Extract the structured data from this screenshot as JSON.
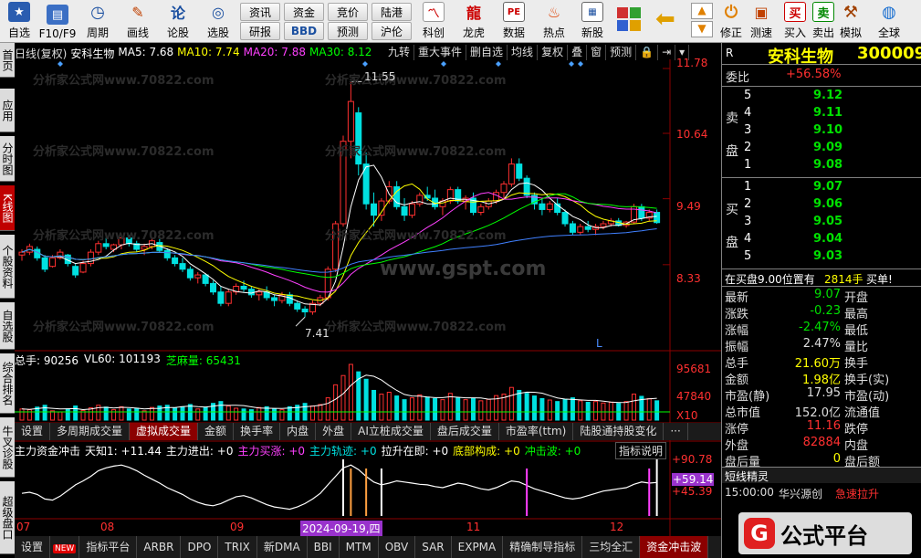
{
  "toolbar": {
    "buttons": [
      {
        "label": "自选",
        "icon": "star-icon"
      },
      {
        "label": "F10/F9",
        "icon": "info-icon"
      },
      {
        "label": "周期",
        "icon": "clock-icon"
      },
      {
        "label": "画线",
        "icon": "pencil-icon"
      },
      {
        "label": "论股",
        "icon": "chat-icon"
      },
      {
        "label": "选股",
        "icon": "scan-icon"
      }
    ],
    "small_top": [
      "资讯",
      "资金",
      "竞价",
      "陆港"
    ],
    "small_bottom": [
      "研报",
      "BBD",
      "预测",
      "沪伦"
    ],
    "buttons2": [
      {
        "label": "科创",
        "icon": "chart-icon"
      },
      {
        "label": "龙虎",
        "icon": "dragon-icon"
      },
      {
        "label": "数据",
        "icon": "pe-icon"
      },
      {
        "label": "热点",
        "icon": "fire-icon"
      },
      {
        "label": "新股",
        "icon": "newstock-icon"
      }
    ],
    "buttons3": [
      {
        "label": "修正",
        "icon": "up-arrow-icon"
      },
      {
        "label": "测速",
        "icon": "speed-icon"
      },
      {
        "label": "买入",
        "icon": "buy-icon"
      },
      {
        "label": "卖出",
        "icon": "sell-icon"
      },
      {
        "label": "模拟",
        "icon": "hammer-icon"
      },
      {
        "label": "全球",
        "icon": "globe-icon"
      }
    ],
    "buy_glyph": "买",
    "sell_glyph": "卖"
  },
  "left_tabs": [
    "首页",
    "应用",
    "分时图",
    "K线图",
    "个股资料",
    "自选股",
    "综合排名",
    "牛叉诊股",
    "超级盘口"
  ],
  "chart": {
    "info": {
      "period": "日线(复权)",
      "name": "安科生物",
      "ma5": "MA5: 7.68",
      "ma10": "MA10: 7.74",
      "ma20": "MA20: 7.88",
      "ma30": "MA30: 8.12"
    },
    "top_tabs": [
      "九转",
      "重大事件",
      "删自选",
      "均线",
      "复权",
      "叠",
      "窗",
      "预测"
    ],
    "price_ticks": [
      "11.78",
      "10.64",
      "9.49",
      "8.33"
    ],
    "high_label": "11.55",
    "low_label": "7.41",
    "l_marker": "L",
    "watermark": "分析家公式网www.70822.com",
    "watermark2": "www.gspt.com",
    "vol_info": {
      "total": "总手: 90256",
      "vl60": "VL60: 101193",
      "sesame": "芝麻量: 65431"
    },
    "vol_ticks": [
      "95681",
      "47840",
      "X10"
    ],
    "tabs": [
      "设置",
      "多周期成交量",
      "虚拟成交量",
      "金额",
      "换手率",
      "内盘",
      "外盘",
      "AI立桩成交量",
      "盘后成交量",
      "市盈率(ttm)",
      "陆股通持股变化",
      "···"
    ],
    "ind_info": {
      "name": "主力资金冲击",
      "tianzhi": "天知1: +11.44",
      "jinchu": "主力进出: +0",
      "maizhang": "主力买涨: +0",
      "guiji": "主力轨迹: +0",
      "lasheng": "拉升在即: +0",
      "dibu": "底部构成: +0",
      "chongji": "冲击波: +0",
      "help": "指标说明"
    },
    "ind_ticks": [
      "+90.78",
      "+59.14",
      "+45.39"
    ],
    "date_labels": [
      "07",
      "08",
      "09",
      "2024-09-19,四",
      "11",
      "12"
    ],
    "ind_tabs": [
      "设置",
      "NEW",
      "指标平台",
      "ARBR",
      "DPO",
      "TRIX",
      "新DMA",
      "BBI",
      "MTM",
      "OBV",
      "SAR",
      "EXPMA",
      "精确制导指标",
      "三均全汇",
      "资金冲击波"
    ],
    "candles": [
      [
        8.5,
        8.6,
        8.4,
        8.55
      ],
      [
        8.55,
        8.7,
        8.5,
        8.65
      ],
      [
        8.6,
        8.65,
        8.4,
        8.45
      ],
      [
        8.45,
        8.5,
        8.2,
        8.25
      ],
      [
        8.3,
        8.5,
        8.28,
        8.45
      ],
      [
        8.45,
        8.6,
        8.42,
        8.55
      ],
      [
        8.5,
        8.52,
        8.3,
        8.35
      ],
      [
        8.3,
        8.35,
        8.1,
        8.15
      ],
      [
        8.2,
        8.4,
        8.18,
        8.35
      ],
      [
        8.35,
        8.6,
        8.3,
        8.55
      ],
      [
        8.55,
        8.75,
        8.5,
        8.7
      ],
      [
        8.7,
        8.8,
        8.6,
        8.65
      ],
      [
        8.6,
        8.7,
        8.55,
        8.68
      ],
      [
        8.68,
        8.85,
        8.6,
        8.8
      ],
      [
        8.8,
        8.85,
        8.65,
        8.7
      ],
      [
        8.7,
        8.75,
        8.55,
        8.6
      ],
      [
        8.6,
        8.7,
        8.5,
        8.65
      ],
      [
        8.65,
        8.8,
        8.6,
        8.75
      ],
      [
        8.72,
        8.78,
        8.55,
        8.58
      ],
      [
        8.58,
        8.62,
        8.4,
        8.45
      ],
      [
        8.45,
        8.5,
        8.3,
        8.35
      ],
      [
        8.35,
        8.45,
        8.2,
        8.25
      ],
      [
        8.25,
        8.3,
        8.05,
        8.1
      ],
      [
        8.1,
        8.2,
        8.0,
        8.15
      ],
      [
        8.15,
        8.18,
        7.95,
        8.0
      ],
      [
        8.0,
        8.05,
        7.8,
        7.85
      ],
      [
        7.85,
        7.95,
        7.6,
        7.65
      ],
      [
        7.65,
        7.9,
        7.6,
        7.85
      ],
      [
        7.85,
        8.0,
        7.8,
        7.95
      ],
      [
        7.95,
        8.05,
        7.85,
        7.9
      ],
      [
        7.9,
        7.95,
        7.75,
        7.8
      ],
      [
        7.8,
        7.9,
        7.7,
        7.85
      ],
      [
        7.85,
        7.95,
        7.7,
        7.75
      ],
      [
        7.75,
        7.8,
        7.6,
        7.7
      ],
      [
        7.7,
        7.85,
        7.65,
        7.8
      ],
      [
        7.8,
        7.85,
        7.6,
        7.65
      ],
      [
        7.65,
        7.7,
        7.5,
        7.55
      ],
      [
        7.55,
        7.6,
        7.41,
        7.5
      ],
      [
        7.5,
        7.7,
        7.45,
        7.65
      ],
      [
        7.65,
        7.8,
        7.6,
        7.75
      ],
      [
        7.75,
        8.3,
        7.7,
        8.25
      ],
      [
        8.25,
        9.1,
        8.2,
        9.05
      ],
      [
        9.05,
        10.6,
        9.0,
        10.5
      ],
      [
        10.5,
        11.55,
        10.2,
        11.2
      ],
      [
        11.0,
        11.1,
        9.9,
        10.1
      ],
      [
        10.1,
        10.3,
        9.3,
        9.4
      ],
      [
        9.4,
        9.6,
        9.0,
        9.2
      ],
      [
        9.2,
        9.5,
        9.1,
        9.45
      ],
      [
        9.45,
        9.8,
        9.4,
        9.7
      ],
      [
        9.7,
        9.8,
        9.3,
        9.35
      ],
      [
        9.35,
        9.5,
        9.1,
        9.2
      ],
      [
        9.2,
        9.45,
        9.15,
        9.4
      ],
      [
        9.4,
        9.6,
        9.35,
        9.55
      ],
      [
        9.55,
        9.7,
        9.45,
        9.5
      ],
      [
        9.5,
        9.65,
        9.3,
        9.35
      ],
      [
        9.35,
        9.5,
        9.2,
        9.45
      ],
      [
        9.45,
        9.7,
        9.4,
        9.65
      ],
      [
        9.65,
        9.7,
        9.4,
        9.45
      ],
      [
        9.45,
        9.55,
        9.3,
        9.5
      ],
      [
        9.5,
        9.6,
        9.2,
        9.25
      ],
      [
        9.25,
        9.4,
        9.2,
        9.35
      ],
      [
        9.35,
        9.5,
        9.3,
        9.45
      ],
      [
        9.45,
        9.65,
        9.4,
        9.6
      ],
      [
        9.6,
        9.8,
        9.5,
        9.75
      ],
      [
        9.75,
        10.2,
        9.7,
        10.1
      ],
      [
        10.1,
        10.2,
        9.8,
        9.85
      ],
      [
        9.85,
        9.9,
        9.5,
        9.55
      ],
      [
        9.55,
        9.6,
        9.3,
        9.4
      ],
      [
        9.4,
        9.5,
        9.2,
        9.3
      ],
      [
        9.3,
        9.45,
        9.25,
        9.4
      ],
      [
        9.4,
        9.5,
        9.2,
        9.25
      ],
      [
        9.25,
        9.3,
        9.0,
        9.05
      ],
      [
        9.05,
        9.1,
        8.85,
        8.9
      ],
      [
        8.9,
        9.05,
        8.85,
        9.0
      ],
      [
        9.0,
        9.1,
        8.9,
        8.95
      ],
      [
        8.95,
        9.05,
        8.85,
        9.0
      ],
      [
        9.0,
        9.1,
        8.95,
        9.05
      ],
      [
        9.05,
        9.15,
        9.0,
        9.1
      ],
      [
        9.1,
        9.15,
        9.0,
        9.02
      ],
      [
        9.02,
        9.1,
        8.98,
        9.08
      ],
      [
        9.08,
        9.4,
        9.05,
        9.35
      ],
      [
        9.35,
        9.4,
        9.1,
        9.15
      ],
      [
        9.15,
        9.3,
        9.1,
        9.25
      ],
      [
        9.25,
        9.3,
        9.05,
        9.07
      ]
    ],
    "volume": [
      30,
      28,
      35,
      40,
      25,
      22,
      30,
      38,
      26,
      33,
      40,
      35,
      28,
      36,
      30,
      32,
      25,
      34,
      38,
      40,
      33,
      36,
      42,
      30,
      35,
      45,
      50,
      38,
      32,
      30,
      28,
      34,
      36,
      30,
      28,
      36,
      40,
      45,
      38,
      42,
      60,
      95,
      120,
      150,
      130,
      110,
      80,
      70,
      75,
      65,
      55,
      60,
      68,
      62,
      58,
      55,
      72,
      60,
      55,
      58,
      52,
      56,
      66,
      70,
      88,
      80,
      72,
      65,
      58,
      54,
      50,
      56,
      60,
      52,
      48,
      50,
      46,
      48,
      45,
      50,
      70,
      64,
      58,
      52
    ],
    "ind": [
      40,
      42,
      38,
      30,
      28,
      35,
      45,
      55,
      62,
      70,
      80,
      85,
      88,
      90,
      86,
      80,
      72,
      65,
      58,
      50,
      44,
      38,
      30,
      24,
      20,
      18,
      22,
      28,
      34,
      36,
      32,
      26,
      20,
      16,
      14,
      12,
      16,
      22,
      30,
      40,
      55,
      70,
      85,
      90,
      82,
      70,
      60,
      55,
      58,
      62,
      60,
      58,
      56,
      55,
      52,
      50,
      54,
      58,
      56,
      52,
      48,
      46,
      50,
      56,
      62,
      60,
      54,
      48,
      44,
      40,
      36,
      32,
      30,
      32,
      36,
      40,
      44,
      46,
      48,
      50,
      56,
      60,
      58,
      59.14
    ]
  },
  "right": {
    "title": "安科生物",
    "code": "300009",
    "r_mark": "R",
    "weibi": {
      "label": "委比",
      "value": "+56.58%"
    },
    "sell_label": [
      "卖",
      "盘"
    ],
    "buy_label": [
      "买",
      "盘"
    ],
    "asks": [
      {
        "lv": "5",
        "p": "9.12"
      },
      {
        "lv": "4",
        "p": "9.11"
      },
      {
        "lv": "3",
        "p": "9.10"
      },
      {
        "lv": "2",
        "p": "9.09"
      },
      {
        "lv": "1",
        "p": "9.08"
      }
    ],
    "bids": [
      {
        "lv": "1",
        "p": "9.07"
      },
      {
        "lv": "2",
        "p": "9.06"
      },
      {
        "lv": "3",
        "p": "9.05"
      },
      {
        "lv": "4",
        "p": "9.04"
      },
      {
        "lv": "5",
        "p": "9.03"
      }
    ],
    "notice": {
      "text": "在买盘9.00位置有",
      "qty": "2814手",
      "tag": "买单!"
    },
    "stats": [
      {
        "k": "最新",
        "v": "9.07",
        "k2": "开盘",
        "c": "#00e000"
      },
      {
        "k": "涨跌",
        "v": "-0.23",
        "k2": "最高",
        "c": "#00e000"
      },
      {
        "k": "涨幅",
        "v": "-2.47%",
        "k2": "最低",
        "c": "#00e000"
      },
      {
        "k": "振幅",
        "v": "2.47%",
        "k2": "量比",
        "c": "#ddd"
      },
      {
        "k": "总手",
        "v": "21.60万",
        "k2": "换手",
        "c": "#ffff00"
      },
      {
        "k": "金额",
        "v": "1.98亿",
        "k2": "换手(实)",
        "c": "#ffff00"
      },
      {
        "k": "市盈(静)",
        "v": "17.95",
        "k2": "市盈(动)",
        "c": "#ddd"
      },
      {
        "k": "总市值",
        "v": "152.0亿",
        "k2": "流通值",
        "c": "#ddd"
      },
      {
        "k": "涨停",
        "v": "11.16",
        "k2": "跌停",
        "c": "#ff3030"
      },
      {
        "k": "外盘",
        "v": "82884",
        "k2": "内盘",
        "c": "#ff3030"
      },
      {
        "k": "盘后量",
        "v": "0",
        "k2": "盘后额",
        "c": "#ffff00"
      }
    ],
    "short_title": "短线精灵",
    "short_item": {
      "time": "15:00:00",
      "name": "华兴源创",
      "event": "急速拉升"
    },
    "logo": "公式平台"
  },
  "colors": {
    "up": "#ff3030",
    "down": "#00e0e0",
    "ma5": "#ffffff",
    "ma10": "#ffff00",
    "ma20": "#ff40ff",
    "ma30": "#00ff00",
    "ma60": "#4080ff"
  }
}
